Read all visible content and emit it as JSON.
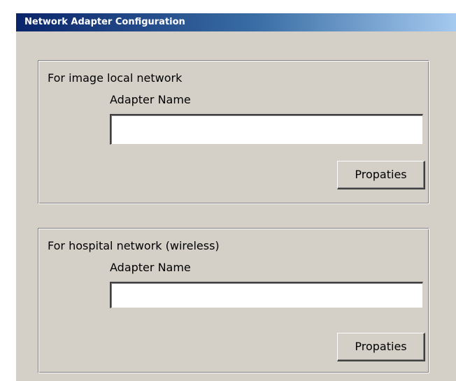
{
  "window": {
    "title": "Network Adapter Configuration"
  },
  "groups": [
    {
      "title": "For image local network",
      "field_label": "Adapter Name",
      "field_value": "",
      "button_label": "Propaties"
    },
    {
      "title": "For hospital network (wireless)",
      "field_label": "Adapter Name",
      "field_value": "",
      "button_label": "Propaties"
    }
  ],
  "colors": {
    "dialog_background": "#d4d0c8",
    "titlebar_start": "#0a246a",
    "titlebar_end": "#a6caf0",
    "title_text": "#ffffff"
  }
}
